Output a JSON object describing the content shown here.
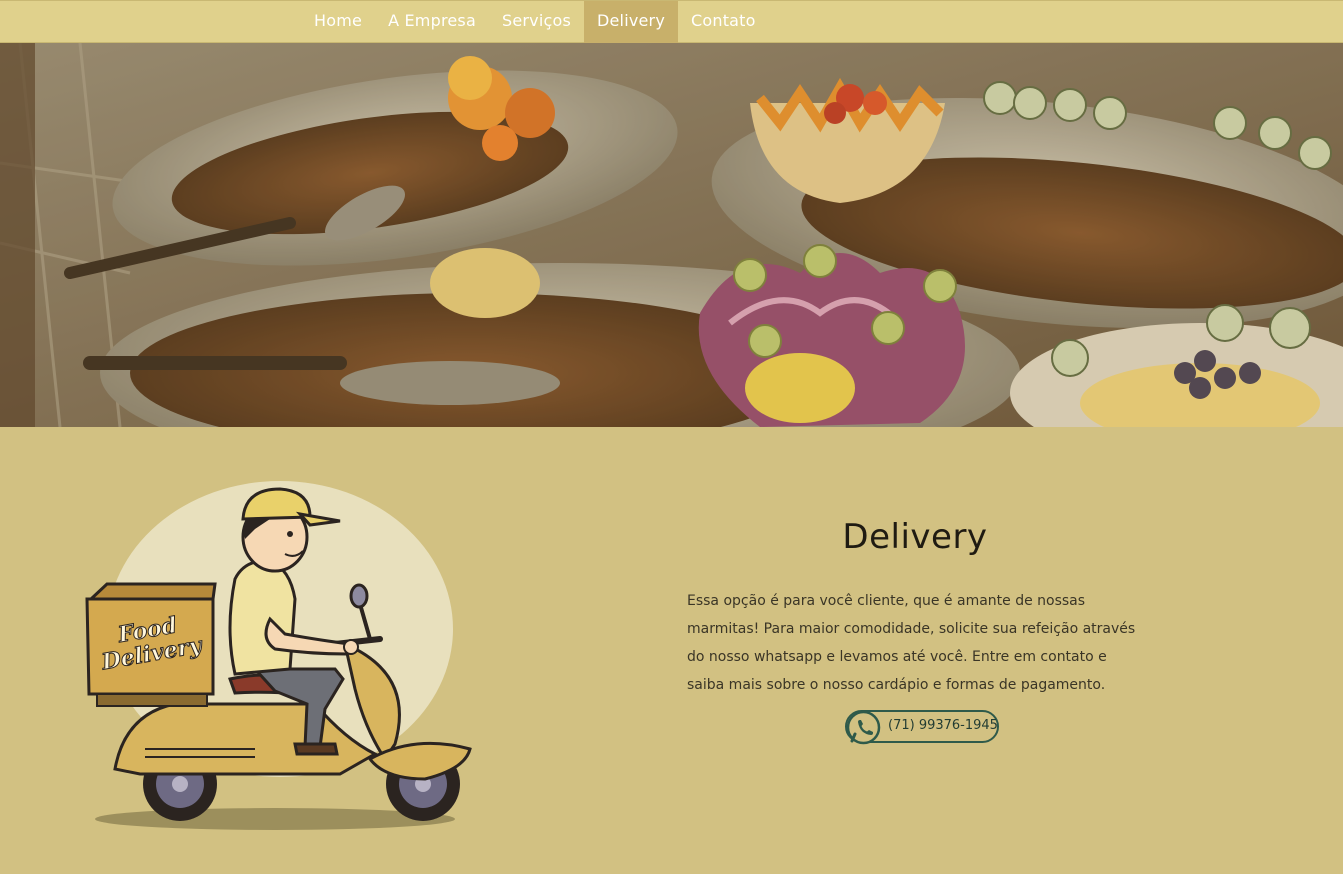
{
  "nav": {
    "items": [
      {
        "label": "Home",
        "active": false
      },
      {
        "label": "A Empresa",
        "active": false
      },
      {
        "label": "Serviços",
        "active": false
      },
      {
        "label": "Delivery",
        "active": true
      },
      {
        "label": "Contato",
        "active": false
      }
    ]
  },
  "hero": {
    "image": "buffet-food-photo"
  },
  "illustration": {
    "box_text_line1": "Food",
    "box_text_line2": "Delivery"
  },
  "delivery": {
    "title": "Delivery",
    "text": "Essa opção é para você cliente, que é amante de nossas marmitas! Para maior comodidade, solicite sua refeição através do nosso whatsapp e levamos até você. Entre em contato e saiba mais sobre o nosso cardápio e formas de pagamento.",
    "whatsapp_number": "(71) 99376-1945",
    "whatsapp_icon": "whatsapp-icon"
  },
  "colors": {
    "nav_bg": "#e0d18c",
    "nav_active": "#c8b06a",
    "page_bg": "#d2c182",
    "accent_green": "#2f5a4a"
  }
}
